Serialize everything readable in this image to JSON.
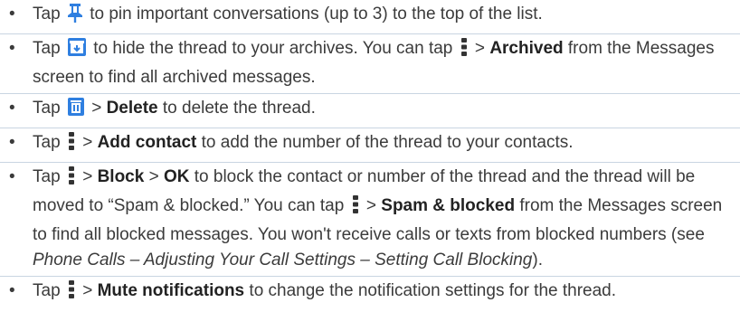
{
  "items": [
    {
      "id": "pin",
      "parts": [
        {
          "t": "text",
          "v": "Tap "
        },
        {
          "t": "icon",
          "v": "pin-icon"
        },
        {
          "t": "text",
          "v": " to pin important conversations (up to 3) to the top of the list."
        }
      ]
    },
    {
      "id": "archive",
      "parts": [
        {
          "t": "text",
          "v": "Tap "
        },
        {
          "t": "icon",
          "v": "archive-icon"
        },
        {
          "t": "text",
          "v": " to hide the thread to your archives. You can tap "
        },
        {
          "t": "icon",
          "v": "more-vert-icon"
        },
        {
          "t": "text",
          "v": " > "
        },
        {
          "t": "bold",
          "v": "Archived"
        },
        {
          "t": "text",
          "v": " from the Messages screen to find all archived messages."
        }
      ]
    },
    {
      "id": "delete",
      "parts": [
        {
          "t": "text",
          "v": "Tap "
        },
        {
          "t": "icon",
          "v": "trash-icon"
        },
        {
          "t": "text",
          "v": " > "
        },
        {
          "t": "bold",
          "v": "Delete"
        },
        {
          "t": "text",
          "v": " to delete the thread."
        }
      ]
    },
    {
      "id": "add-contact",
      "parts": [
        {
          "t": "text",
          "v": "Tap "
        },
        {
          "t": "icon",
          "v": "more-vert-icon"
        },
        {
          "t": "text",
          "v": " > "
        },
        {
          "t": "bold",
          "v": "Add contact"
        },
        {
          "t": "text",
          "v": " to add the number of the thread to your contacts."
        }
      ]
    },
    {
      "id": "block",
      "parts": [
        {
          "t": "text",
          "v": "Tap "
        },
        {
          "t": "icon",
          "v": "more-vert-icon"
        },
        {
          "t": "text",
          "v": " > "
        },
        {
          "t": "bold",
          "v": "Block"
        },
        {
          "t": "text",
          "v": " > "
        },
        {
          "t": "bold",
          "v": "OK"
        },
        {
          "t": "text",
          "v": " to block the contact or number of the thread and the thread will be moved to “Spam & blocked.” You can tap "
        },
        {
          "t": "icon",
          "v": "more-vert-icon"
        },
        {
          "t": "text",
          "v": " > "
        },
        {
          "t": "bold",
          "v": "Spam & blocked"
        },
        {
          "t": "text",
          "v": " from the Messages screen to find all blocked messages. You won't receive calls or texts from blocked numbers (see "
        },
        {
          "t": "italic",
          "v": "Phone Calls – Adjusting Your Call Settings – Setting Call Blocking"
        },
        {
          "t": "text",
          "v": ")."
        }
      ]
    },
    {
      "id": "mute",
      "parts": [
        {
          "t": "text",
          "v": "Tap "
        },
        {
          "t": "icon",
          "v": "more-vert-icon"
        },
        {
          "t": "text",
          "v": " > "
        },
        {
          "t": "bold",
          "v": "Mute notifications"
        },
        {
          "t": "text",
          "v": " to change the notification settings for the thread."
        }
      ]
    }
  ],
  "bullet": "•",
  "colors": {
    "icon_blue": "#2f7fe0",
    "icon_dark": "#333333",
    "divider": "#c9d5e2",
    "text": "#3b3b3b"
  }
}
